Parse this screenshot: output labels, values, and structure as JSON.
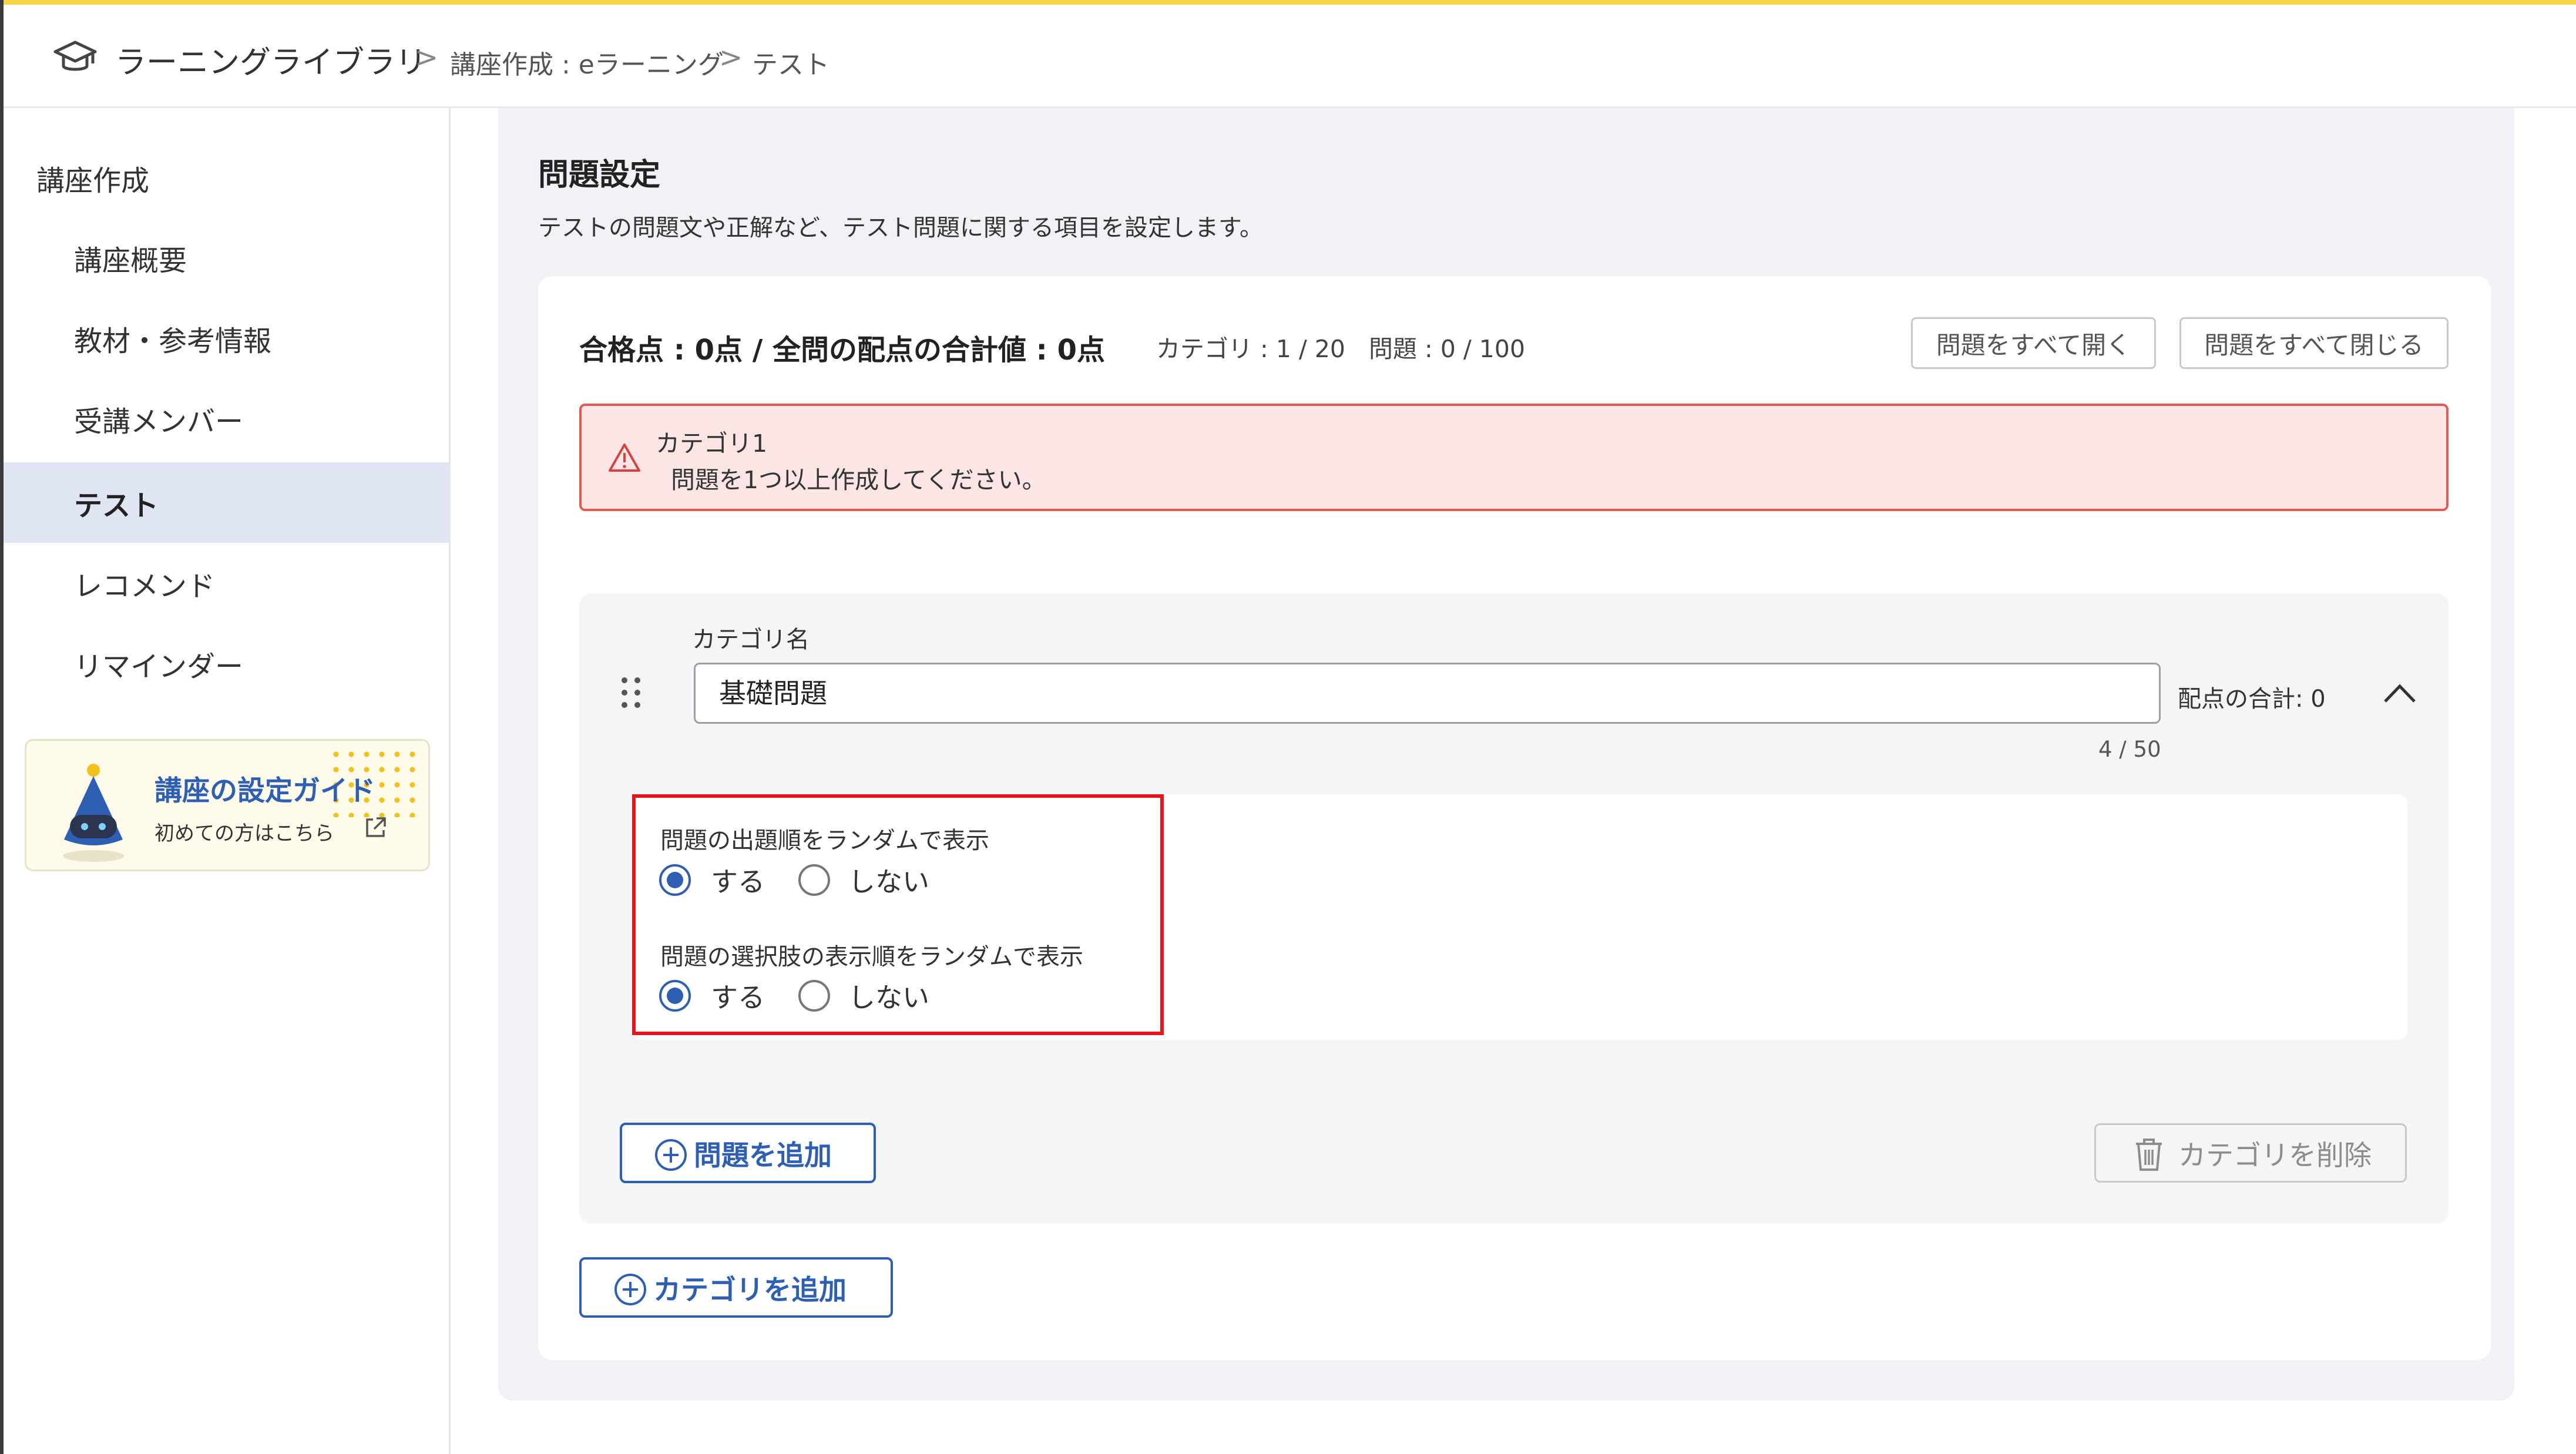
{
  "breadcrumb": {
    "root": "ラーニングライブラリ",
    "level1": "講座作成 : eラーニング",
    "level2": "テスト",
    "separator": ">"
  },
  "sidebar": {
    "title": "講座作成",
    "items": [
      {
        "label": "講座概要",
        "active": false
      },
      {
        "label": "教材・参考情報",
        "active": false
      },
      {
        "label": "受講メンバー",
        "active": false
      },
      {
        "label": "テスト",
        "active": true
      },
      {
        "label": "レコメンド",
        "active": false
      },
      {
        "label": "リマインダー",
        "active": false
      }
    ],
    "guide": {
      "title": "講座の設定ガイド",
      "subtitle": "初めての方はこちら"
    }
  },
  "main": {
    "title": "問題設定",
    "description": "テストの問題文や正解など、テスト問題に関する項目を設定します。",
    "summary": {
      "score": "合格点 : 0点 / 全問の配点の合計値 : 0点",
      "category_count": "カテゴリ : 1 / 20",
      "question_count": "問題 : 0 / 100"
    },
    "expand_all_label": "問題をすべて開く",
    "collapse_all_label": "問題をすべて閉じる",
    "alert": {
      "line1": "カテゴリ1",
      "line2": "問題を1つ以上作成してください。"
    },
    "category": {
      "name_label": "カテゴリ名",
      "name_value": "基礎問題",
      "char_count": "4 / 50",
      "score_total": "配点の合計: 0",
      "options": [
        {
          "label": "問題の出題順をランダムで表示",
          "yes": "する",
          "no": "しない",
          "selected": "yes"
        },
        {
          "label": "問題の選択肢の表示順をランダムで表示",
          "yes": "する",
          "no": "しない",
          "selected": "yes"
        }
      ],
      "add_question_label": "問題を追加",
      "delete_category_label": "カテゴリを削除"
    },
    "add_category_label": "カテゴリを追加"
  },
  "colors": {
    "accent": "#2f5fb3",
    "alert_bg": "#fbe5e5",
    "alert_border": "#e05a5a",
    "highlight_frame": "#e4151c",
    "active_nav": "#dfe5f3",
    "top_line": "#f5d547"
  }
}
